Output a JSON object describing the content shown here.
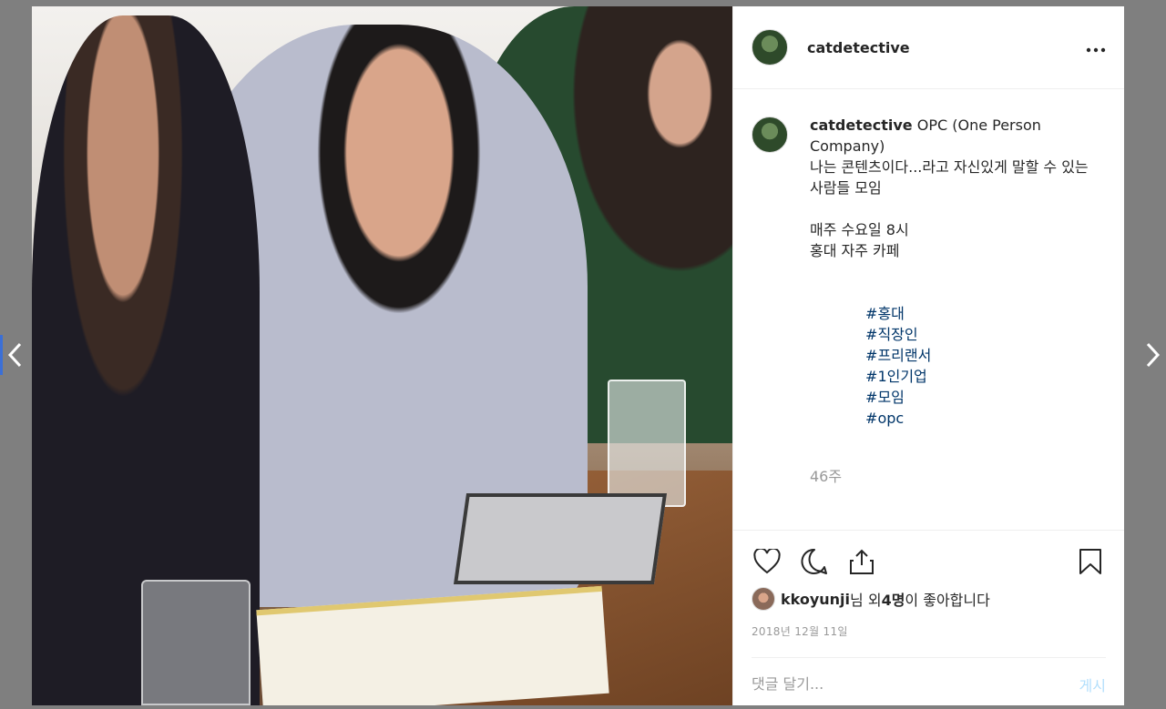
{
  "navigation": {
    "prev_icon": "chevron-left-icon",
    "next_icon": "chevron-right-icon"
  },
  "post": {
    "username": "catdetective",
    "more_icon": "more-horizontal-icon",
    "caption": {
      "username": "catdetective",
      "text_line1": " OPC (One Person Company)",
      "text_line2": "나는 콘텐츠이다...라고 자신있게 말할 수 있는 사람들 모임",
      "text_line3": "매주 수요일 8시",
      "text_line4": "홍대 자주 카페",
      "hashtags": [
        "#홍대",
        "#직장인",
        "#프리랜서",
        "#1인기업",
        "#모임",
        "#opc"
      ]
    },
    "age": "46주",
    "likes": {
      "user": "kkoyunji",
      "text_mid": "님 외 ",
      "count": "4명",
      "text_end": "이 좋아합니다"
    },
    "date": "2018년 12월 11일",
    "comment": {
      "placeholder": "댓글 달기...",
      "post_label": "게시"
    }
  },
  "colors": {
    "hashtag": "#003569",
    "muted": "#999999",
    "post_button": "#b2dffc"
  }
}
